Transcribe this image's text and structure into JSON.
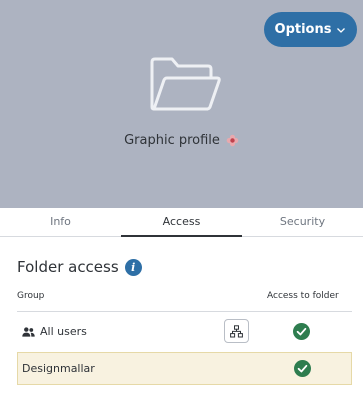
{
  "header": {
    "options_label": "Options",
    "folder_title": "Graphic profile",
    "folder_icon": "folder-icon",
    "title_badge_icon": "flower-icon"
  },
  "tabs": [
    {
      "label": "Info",
      "active": false
    },
    {
      "label": "Access",
      "active": true
    },
    {
      "label": "Security",
      "active": false
    }
  ],
  "folder_access": {
    "title": "Folder access",
    "info_glyph": "i",
    "columns": {
      "group": "Group",
      "access": "Access to folder"
    },
    "rows": [
      {
        "name": "All users",
        "icon": "users-icon",
        "has_hierarchy_button": true,
        "access": true,
        "highlighted": false
      },
      {
        "name": "Designmallar",
        "icon": "",
        "has_hierarchy_button": false,
        "access": true,
        "highlighted": true
      }
    ]
  },
  "colors": {
    "header_bg": "#adb3c1",
    "accent": "#2e6fa6",
    "check_green": "#2e7d4f",
    "highlight_row_bg": "#f8f2e0"
  }
}
